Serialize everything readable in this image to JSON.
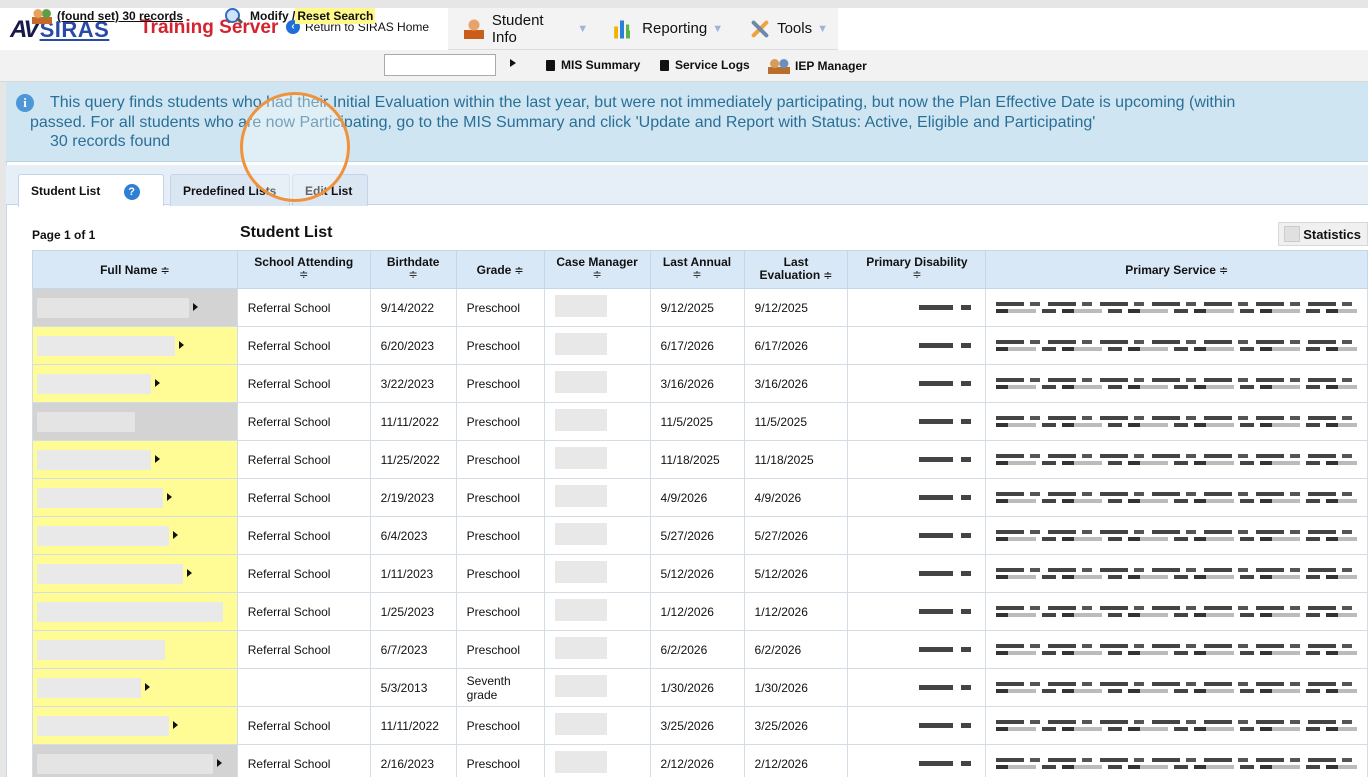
{
  "app": {
    "logo_av": "AV",
    "logo_siras": "SIRAS",
    "server": "Training Server",
    "return_home": "Return to SIRAS Home"
  },
  "menus": [
    {
      "label": "Student Info",
      "icon": "student-icon"
    },
    {
      "label": "Reporting",
      "icon": "reporting-icon"
    },
    {
      "label": "Tools",
      "icon": "tools-icon"
    }
  ],
  "toolbar": {
    "found_set": "(found set) 30 records",
    "modify": "Modify / ",
    "reset_search": "Reset Search",
    "search_value": "",
    "mis_summary": "MIS Summary",
    "service_logs": "Service Logs",
    "iep_manager": "IEP Manager"
  },
  "info": {
    "line1": "This query finds students who had their Initial Evaluation within the last year, but were not immediately participating, but now the Plan Effective Date is upcoming (within",
    "line2": "passed. For all students who are now Participating, go to the MIS Summary and click 'Update and Report with Status: Active, Eligible and Participating'",
    "line3": "30 records found"
  },
  "tabs": [
    {
      "label": "Student List"
    },
    {
      "label": "Predefined Lists"
    },
    {
      "label": "Edit List"
    }
  ],
  "list": {
    "page": "Page 1 of 1",
    "title": "Student List",
    "statistics": "Statistics"
  },
  "columns": {
    "full_name": "Full Name",
    "school": "School Attending",
    "birthdate": "Birthdate",
    "grade": "Grade",
    "case_manager": "Case Manager",
    "last_annual": "Last Annual",
    "last_eval_1": "Last",
    "last_eval_2": "Evaluation",
    "primary_disability": "Primary Disability",
    "primary_service": "Primary Service",
    "sort_glyph": "≑"
  },
  "rows": [
    {
      "school": "Referral School",
      "birthdate": "9/14/2022",
      "grade": "Preschool",
      "last_annual": "9/12/2025",
      "last_eval": "9/12/2025",
      "color": "gray"
    },
    {
      "school": "Referral School",
      "birthdate": "6/20/2023",
      "grade": "Preschool",
      "last_annual": "6/17/2026",
      "last_eval": "6/17/2026",
      "color": "yellow"
    },
    {
      "school": "Referral School",
      "birthdate": "3/22/2023",
      "grade": "Preschool",
      "last_annual": "3/16/2026",
      "last_eval": "3/16/2026",
      "color": "yellow"
    },
    {
      "school": "Referral School",
      "birthdate": "11/11/2022",
      "grade": "Preschool",
      "last_annual": "11/5/2025",
      "last_eval": "11/5/2025",
      "color": "gray"
    },
    {
      "school": "Referral School",
      "birthdate": "11/25/2022",
      "grade": "Preschool",
      "last_annual": "11/18/2025",
      "last_eval": "11/18/2025",
      "color": "yellow"
    },
    {
      "school": "Referral School",
      "birthdate": "2/19/2023",
      "grade": "Preschool",
      "last_annual": "4/9/2026",
      "last_eval": "4/9/2026",
      "color": "yellow"
    },
    {
      "school": "Referral School",
      "birthdate": "6/4/2023",
      "grade": "Preschool",
      "last_annual": "5/27/2026",
      "last_eval": "5/27/2026",
      "color": "yellow"
    },
    {
      "school": "Referral School",
      "birthdate": "1/11/2023",
      "grade": "Preschool",
      "last_annual": "5/12/2026",
      "last_eval": "5/12/2026",
      "color": "yellow"
    },
    {
      "school": "Referral School",
      "birthdate": "1/25/2023",
      "grade": "Preschool",
      "last_annual": "1/12/2026",
      "last_eval": "1/12/2026",
      "color": "yellow"
    },
    {
      "school": "Referral School",
      "birthdate": "6/7/2023",
      "grade": "Preschool",
      "last_annual": "6/2/2026",
      "last_eval": "6/2/2026",
      "color": "yellow"
    },
    {
      "school": "",
      "birthdate": "5/3/2013",
      "grade": "Seventh grade",
      "last_annual": "1/30/2026",
      "last_eval": "1/30/2026",
      "color": "yellow"
    },
    {
      "school": "Referral School",
      "birthdate": "11/11/2022",
      "grade": "Preschool",
      "last_annual": "3/25/2026",
      "last_eval": "3/25/2026",
      "color": "yellow"
    },
    {
      "school": "Referral School",
      "birthdate": "2/16/2023",
      "grade": "Preschool",
      "last_annual": "2/12/2026",
      "last_eval": "2/12/2026",
      "color": "gray"
    }
  ]
}
